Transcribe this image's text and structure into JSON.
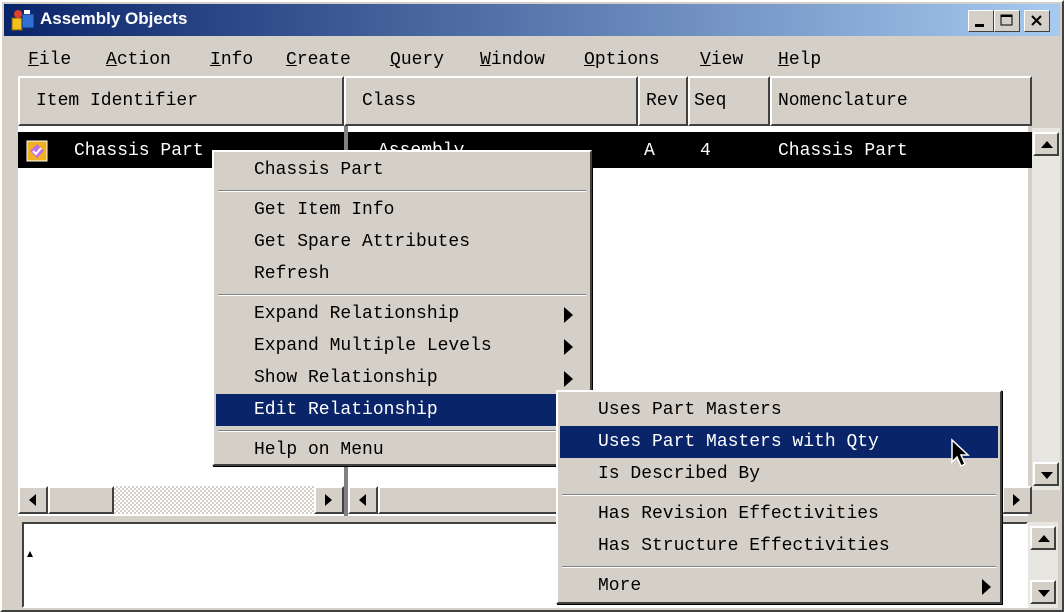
{
  "window": {
    "title": "Assembly Objects"
  },
  "menubar": [
    {
      "label": "File",
      "u": "F",
      "rest": "ile"
    },
    {
      "label": "Action",
      "u": "A",
      "rest": "ction"
    },
    {
      "label": "Info",
      "u": "I",
      "rest": "nfo"
    },
    {
      "label": "Create",
      "u": "C",
      "rest": "reate"
    },
    {
      "label": "Query",
      "u": "Q",
      "rest": "uery"
    },
    {
      "label": "Window",
      "u": "W",
      "rest": "indow"
    },
    {
      "label": "Options",
      "u": "O",
      "rest": "ptions"
    },
    {
      "label": "View",
      "u": "V",
      "rest": "iew"
    },
    {
      "label": "Help",
      "u": "H",
      "rest": "elp"
    }
  ],
  "columns": {
    "item_identifier": "Item Identifier",
    "class": "Class",
    "rev": "Rev",
    "seq": "Seq",
    "nomenclature": "Nomenclature"
  },
  "row": {
    "item_identifier": "Chassis Part",
    "class": "Assembly",
    "rev": "A",
    "seq": "4",
    "nomenclature": "Chassis Part"
  },
  "context_menu": {
    "header": "Chassis Part",
    "get_item_info": "Get Item Info",
    "get_spare_attributes": "Get Spare Attributes",
    "refresh": "Refresh",
    "expand_relationship": "Expand Relationship",
    "expand_multiple_levels": "Expand Multiple Levels",
    "show_relationship": "Show Relationship",
    "edit_relationship": "Edit Relationship",
    "help_on_menu": "Help on Menu"
  },
  "submenu": {
    "uses_part_masters": "Uses Part Masters",
    "uses_part_masters_with_qty": "Uses Part Masters with Qty",
    "is_described_by": "Is Described By",
    "has_revision_effectivities": "Has Revision Effectivities",
    "has_structure_effectivities": "Has Structure Effectivities",
    "more": "More"
  },
  "colors": {
    "title_gradient_start": "#0a246a",
    "title_gradient_end": "#a6caf0",
    "menu_highlight": "#0a246a",
    "row_selection": "#000000",
    "face": "#d4d0c8"
  }
}
